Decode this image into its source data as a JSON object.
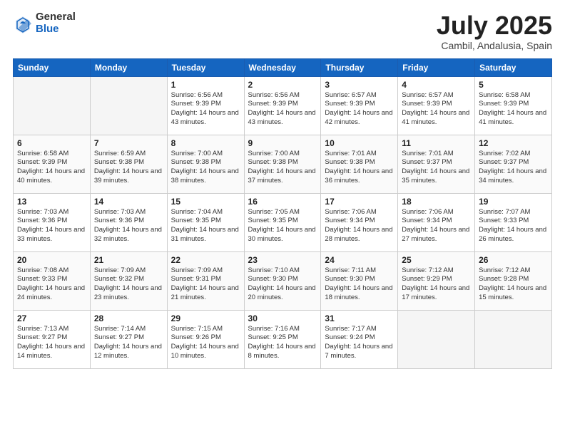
{
  "logo": {
    "general": "General",
    "blue": "Blue"
  },
  "title": {
    "month_year": "July 2025",
    "location": "Cambil, Andalusia, Spain"
  },
  "days_of_week": [
    "Sunday",
    "Monday",
    "Tuesday",
    "Wednesday",
    "Thursday",
    "Friday",
    "Saturday"
  ],
  "weeks": [
    [
      {
        "day": "",
        "detail": ""
      },
      {
        "day": "",
        "detail": ""
      },
      {
        "day": "1",
        "detail": "Sunrise: 6:56 AM\nSunset: 9:39 PM\nDaylight: 14 hours and 43 minutes."
      },
      {
        "day": "2",
        "detail": "Sunrise: 6:56 AM\nSunset: 9:39 PM\nDaylight: 14 hours and 43 minutes."
      },
      {
        "day": "3",
        "detail": "Sunrise: 6:57 AM\nSunset: 9:39 PM\nDaylight: 14 hours and 42 minutes."
      },
      {
        "day": "4",
        "detail": "Sunrise: 6:57 AM\nSunset: 9:39 PM\nDaylight: 14 hours and 41 minutes."
      },
      {
        "day": "5",
        "detail": "Sunrise: 6:58 AM\nSunset: 9:39 PM\nDaylight: 14 hours and 41 minutes."
      }
    ],
    [
      {
        "day": "6",
        "detail": "Sunrise: 6:58 AM\nSunset: 9:39 PM\nDaylight: 14 hours and 40 minutes."
      },
      {
        "day": "7",
        "detail": "Sunrise: 6:59 AM\nSunset: 9:38 PM\nDaylight: 14 hours and 39 minutes."
      },
      {
        "day": "8",
        "detail": "Sunrise: 7:00 AM\nSunset: 9:38 PM\nDaylight: 14 hours and 38 minutes."
      },
      {
        "day": "9",
        "detail": "Sunrise: 7:00 AM\nSunset: 9:38 PM\nDaylight: 14 hours and 37 minutes."
      },
      {
        "day": "10",
        "detail": "Sunrise: 7:01 AM\nSunset: 9:38 PM\nDaylight: 14 hours and 36 minutes."
      },
      {
        "day": "11",
        "detail": "Sunrise: 7:01 AM\nSunset: 9:37 PM\nDaylight: 14 hours and 35 minutes."
      },
      {
        "day": "12",
        "detail": "Sunrise: 7:02 AM\nSunset: 9:37 PM\nDaylight: 14 hours and 34 minutes."
      }
    ],
    [
      {
        "day": "13",
        "detail": "Sunrise: 7:03 AM\nSunset: 9:36 PM\nDaylight: 14 hours and 33 minutes."
      },
      {
        "day": "14",
        "detail": "Sunrise: 7:03 AM\nSunset: 9:36 PM\nDaylight: 14 hours and 32 minutes."
      },
      {
        "day": "15",
        "detail": "Sunrise: 7:04 AM\nSunset: 9:35 PM\nDaylight: 14 hours and 31 minutes."
      },
      {
        "day": "16",
        "detail": "Sunrise: 7:05 AM\nSunset: 9:35 PM\nDaylight: 14 hours and 30 minutes."
      },
      {
        "day": "17",
        "detail": "Sunrise: 7:06 AM\nSunset: 9:34 PM\nDaylight: 14 hours and 28 minutes."
      },
      {
        "day": "18",
        "detail": "Sunrise: 7:06 AM\nSunset: 9:34 PM\nDaylight: 14 hours and 27 minutes."
      },
      {
        "day": "19",
        "detail": "Sunrise: 7:07 AM\nSunset: 9:33 PM\nDaylight: 14 hours and 26 minutes."
      }
    ],
    [
      {
        "day": "20",
        "detail": "Sunrise: 7:08 AM\nSunset: 9:33 PM\nDaylight: 14 hours and 24 minutes."
      },
      {
        "day": "21",
        "detail": "Sunrise: 7:09 AM\nSunset: 9:32 PM\nDaylight: 14 hours and 23 minutes."
      },
      {
        "day": "22",
        "detail": "Sunrise: 7:09 AM\nSunset: 9:31 PM\nDaylight: 14 hours and 21 minutes."
      },
      {
        "day": "23",
        "detail": "Sunrise: 7:10 AM\nSunset: 9:30 PM\nDaylight: 14 hours and 20 minutes."
      },
      {
        "day": "24",
        "detail": "Sunrise: 7:11 AM\nSunset: 9:30 PM\nDaylight: 14 hours and 18 minutes."
      },
      {
        "day": "25",
        "detail": "Sunrise: 7:12 AM\nSunset: 9:29 PM\nDaylight: 14 hours and 17 minutes."
      },
      {
        "day": "26",
        "detail": "Sunrise: 7:12 AM\nSunset: 9:28 PM\nDaylight: 14 hours and 15 minutes."
      }
    ],
    [
      {
        "day": "27",
        "detail": "Sunrise: 7:13 AM\nSunset: 9:27 PM\nDaylight: 14 hours and 14 minutes."
      },
      {
        "day": "28",
        "detail": "Sunrise: 7:14 AM\nSunset: 9:27 PM\nDaylight: 14 hours and 12 minutes."
      },
      {
        "day": "29",
        "detail": "Sunrise: 7:15 AM\nSunset: 9:26 PM\nDaylight: 14 hours and 10 minutes."
      },
      {
        "day": "30",
        "detail": "Sunrise: 7:16 AM\nSunset: 9:25 PM\nDaylight: 14 hours and 8 minutes."
      },
      {
        "day": "31",
        "detail": "Sunrise: 7:17 AM\nSunset: 9:24 PM\nDaylight: 14 hours and 7 minutes."
      },
      {
        "day": "",
        "detail": ""
      },
      {
        "day": "",
        "detail": ""
      }
    ]
  ]
}
